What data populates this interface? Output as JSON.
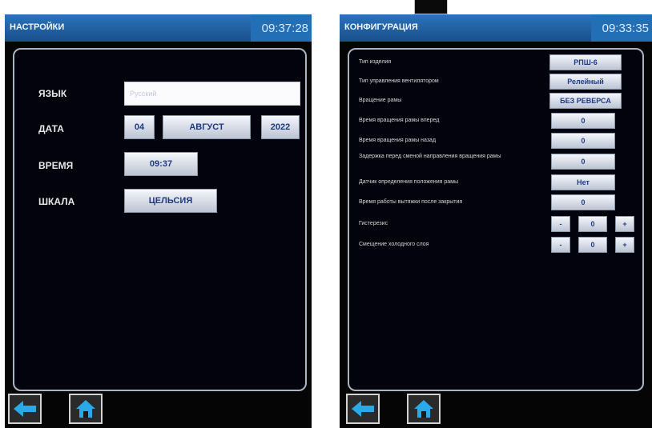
{
  "settings": {
    "title": "НАСТРОЙКИ",
    "clock": "09:37:28",
    "rows": {
      "language_label": "ЯЗЫК",
      "language_value": "Русский",
      "date_label": "ДАТА",
      "day": "04",
      "month": "АВГУСТ",
      "year": "2022",
      "time_label": "ВРЕМЯ",
      "time_value": "09:37",
      "scale_label": "ШКАЛА",
      "scale_value": "ЦЕЛЬСИЯ"
    }
  },
  "config": {
    "title": "КОНФИГУРАЦИЯ",
    "clock": "09:33:35",
    "rows": [
      {
        "label": "Тип изделия",
        "value": "РПШ-6"
      },
      {
        "label": "Тип управления вентилятором",
        "value": "Релейный"
      },
      {
        "label": "Вращение рамы",
        "value": "БЕЗ РЕВЕРСА"
      },
      {
        "label": "Время вращения рамы вперед",
        "value": "0"
      },
      {
        "label": "Время вращения рамы назад",
        "value": "0"
      },
      {
        "label": "Задержка перед сменой направления вращения рамы",
        "value": "0"
      },
      {
        "label": "Датчик определения положения рамы",
        "value": "Нет"
      },
      {
        "label": "Время работы вытяжки после закрытия",
        "value": "0"
      },
      {
        "label": "Гистерезис",
        "minus": "-",
        "value": "0",
        "plus": "+"
      },
      {
        "label": "Смещение холодного слоя",
        "minus": "-",
        "value": "0",
        "plus": "+"
      }
    ]
  },
  "nav": {
    "back_icon": "arrow-left-icon",
    "home_icon": "home-icon",
    "icon_color": "#2aa8e8"
  }
}
